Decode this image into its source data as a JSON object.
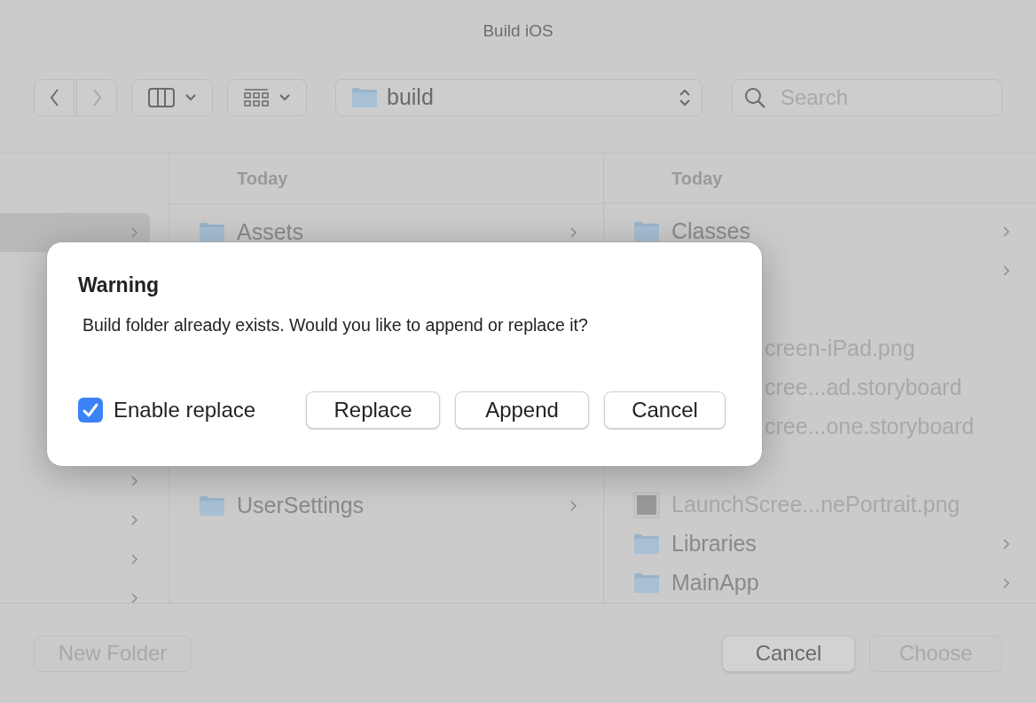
{
  "window": {
    "title": "Build iOS"
  },
  "toolbar": {
    "back": {
      "disabled": false
    },
    "forward": {
      "disabled": true
    },
    "path": "build",
    "search": {
      "placeholder": "Search"
    }
  },
  "sidebar": {
    "rows": [
      {
        "kind": "row",
        "selected": true
      },
      {
        "kind": "covered"
      },
      {
        "kind": "row",
        "selected": false
      },
      {
        "kind": "row",
        "selected": false
      },
      {
        "kind": "row",
        "selected": false
      },
      {
        "kind": "row",
        "selected": false
      }
    ]
  },
  "columns": [
    {
      "header": "Today",
      "items": [
        {
          "kind": "folder",
          "name": "Assets",
          "chevron": true,
          "disabled": false
        },
        {
          "kind": "covered"
        },
        {
          "kind": "covered"
        },
        {
          "kind": "covered"
        },
        {
          "kind": "covered"
        },
        {
          "kind": "covered"
        },
        {
          "kind": "covered"
        },
        {
          "kind": "folder",
          "name": "UserSettings",
          "chevron": true,
          "disabled": false
        }
      ]
    },
    {
      "header": "Today",
      "items": [
        {
          "kind": "folder",
          "name": "Classes",
          "chevron": true,
          "disabled": false
        },
        {
          "kind": "covered",
          "chevron": true
        },
        {
          "kind": "covered"
        },
        {
          "kind": "partial",
          "name": "creen-iPad.png",
          "chevron": false,
          "disabled": true
        },
        {
          "kind": "partial",
          "name": "cree...ad.storyboard",
          "chevron": false,
          "disabled": true
        },
        {
          "kind": "partial",
          "name": "cree...one.storyboard",
          "chevron": false,
          "disabled": true
        },
        {
          "kind": "covered"
        },
        {
          "kind": "image",
          "name": "LaunchScree...nePortrait.png",
          "chevron": false,
          "disabled": true
        },
        {
          "kind": "folder",
          "name": "Libraries",
          "chevron": true,
          "disabled": false
        },
        {
          "kind": "folder",
          "name": "MainApp",
          "chevron": true,
          "disabled": false
        }
      ]
    }
  ],
  "footer": {
    "new_folder": {
      "label": "New Folder",
      "disabled": true
    },
    "cancel": {
      "label": "Cancel",
      "disabled": false
    },
    "choose": {
      "label": "Choose",
      "disabled": true
    }
  },
  "dialog": {
    "title": "Warning",
    "message": "Build folder already exists. Would you like to append or replace it?",
    "checkbox": {
      "label": "Enable replace",
      "checked": true
    },
    "buttons": [
      "Replace",
      "Append",
      "Cancel"
    ]
  }
}
